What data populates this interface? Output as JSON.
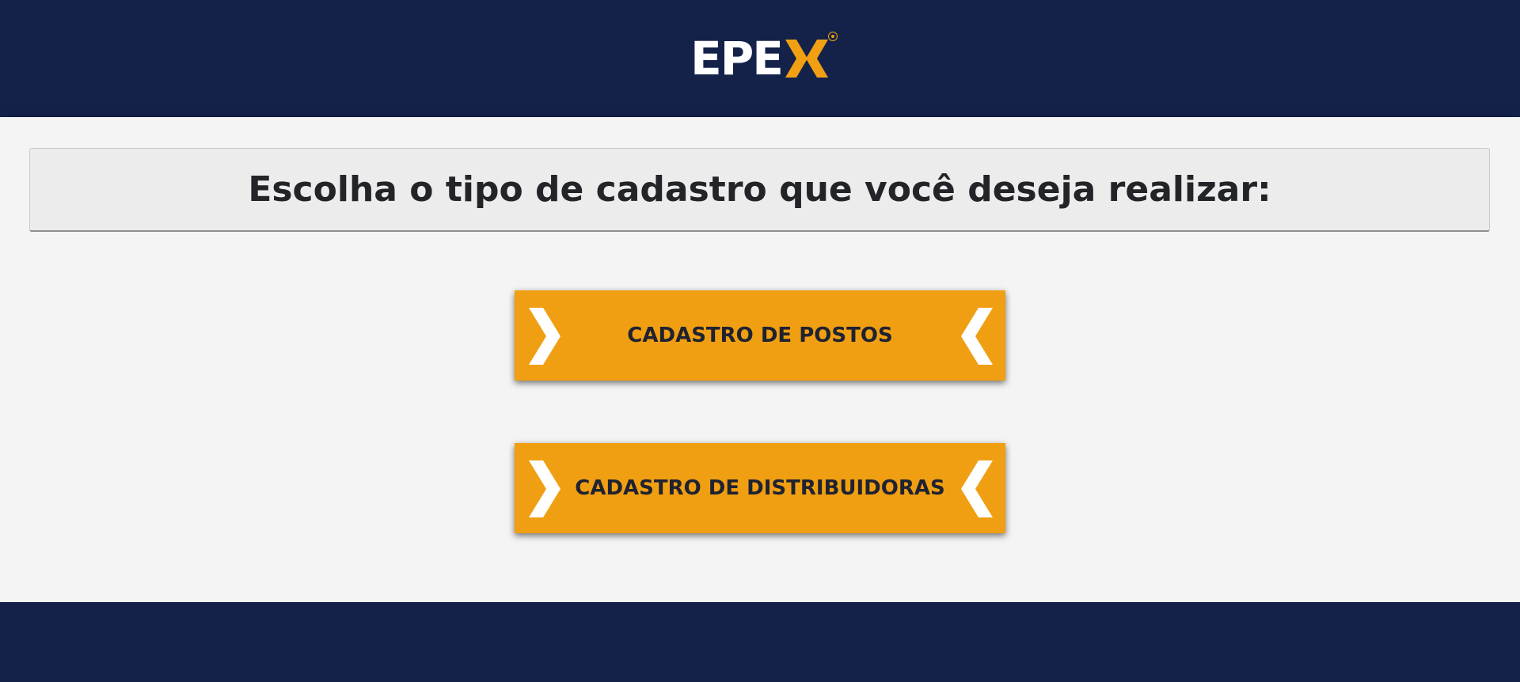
{
  "header": {
    "logo_text": "EPE",
    "logo_accent_letter": "X",
    "brand_accent_color": "#f0a012",
    "background_color": "#14224a"
  },
  "main": {
    "title": "Escolha o tipo de cadastro que você deseja realizar:",
    "buttons": [
      {
        "label": "CADASTRO DE POSTOS",
        "icon_left": "chevron-right-icon",
        "icon_right": "chevron-left-icon"
      },
      {
        "label": "CADASTRO DE DISTRIBUIDORAS",
        "icon_left": "chevron-right-icon",
        "icon_right": "chevron-left-icon"
      }
    ],
    "button_color": "#f09f12"
  }
}
